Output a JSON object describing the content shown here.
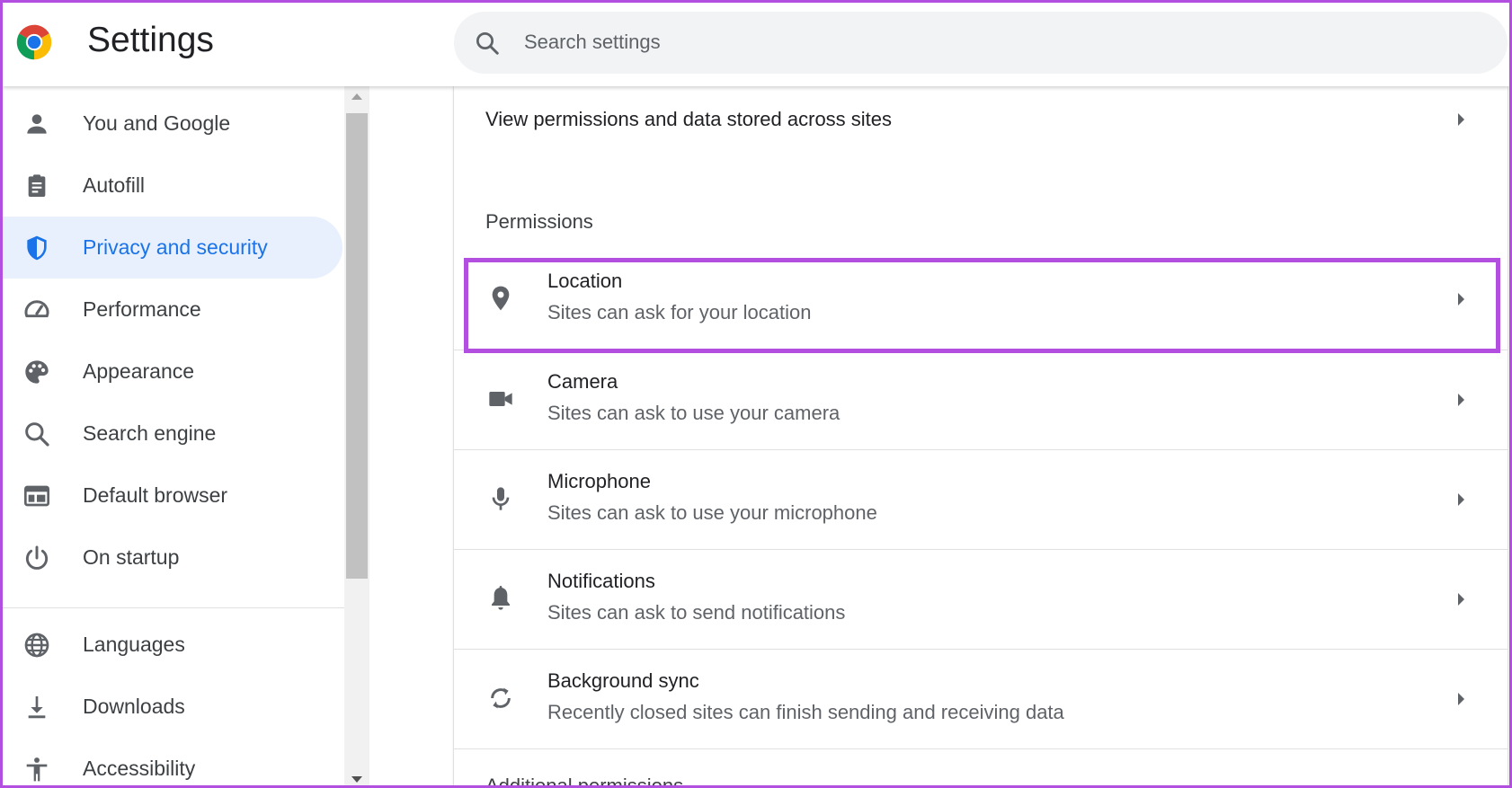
{
  "app": {
    "title": "Settings"
  },
  "search": {
    "placeholder": "Search settings"
  },
  "colors": {
    "accent": "#1a73e8",
    "active_bg": "#e8f0fe",
    "highlight": "#b24fe0"
  },
  "sidebar": {
    "items": [
      {
        "label": "You and Google",
        "icon": "person-icon"
      },
      {
        "label": "Autofill",
        "icon": "clipboard-icon"
      },
      {
        "label": "Privacy and security",
        "icon": "shield-icon",
        "active": true
      },
      {
        "label": "Performance",
        "icon": "speedometer-icon"
      },
      {
        "label": "Appearance",
        "icon": "palette-icon"
      },
      {
        "label": "Search engine",
        "icon": "search-icon"
      },
      {
        "label": "Default browser",
        "icon": "browser-window-icon"
      },
      {
        "label": "On startup",
        "icon": "power-icon"
      },
      {
        "label": "Languages",
        "icon": "globe-icon"
      },
      {
        "label": "Downloads",
        "icon": "download-icon"
      },
      {
        "label": "Accessibility",
        "icon": "accessibility-icon"
      }
    ]
  },
  "main": {
    "view_permissions_label": "View permissions and data stored across sites",
    "permissions_title": "Permissions",
    "permissions": [
      {
        "title": "Location",
        "subtitle": "Sites can ask for your location",
        "icon": "location-pin-icon"
      },
      {
        "title": "Camera",
        "subtitle": "Sites can ask to use your camera",
        "icon": "camera-icon"
      },
      {
        "title": "Microphone",
        "subtitle": "Sites can ask to use your microphone",
        "icon": "microphone-icon"
      },
      {
        "title": "Notifications",
        "subtitle": "Sites can ask to send notifications",
        "icon": "bell-icon"
      },
      {
        "title": "Background sync",
        "subtitle": "Recently closed sites can finish sending and receiving data",
        "icon": "sync-icon"
      }
    ],
    "cutoff_label": "Additional permissions"
  }
}
